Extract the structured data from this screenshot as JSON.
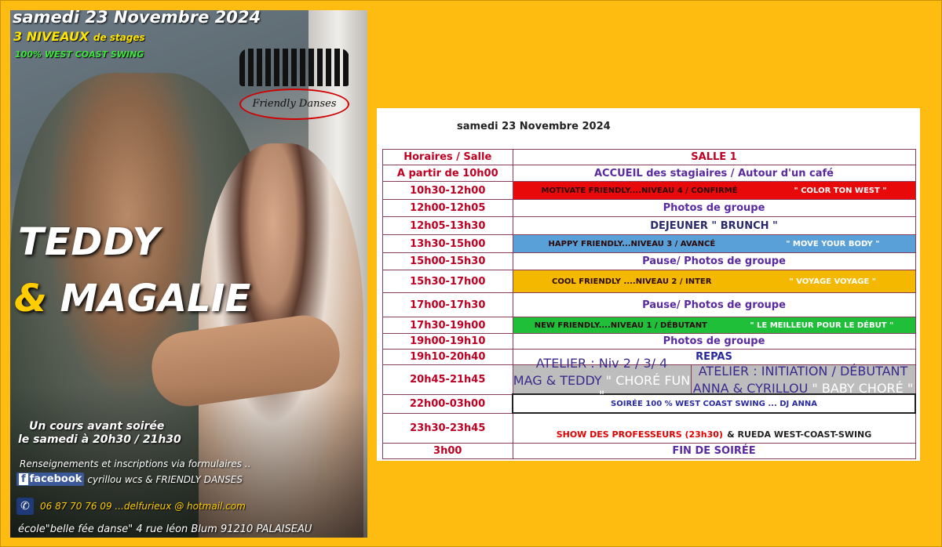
{
  "poster": {
    "date": "samedi 23 Novembre 2024",
    "levels_big": "3 NIVEAUX",
    "levels_small": "de stages",
    "style": "100% WEST COAST SWING",
    "logo_text": "Friendly Danses",
    "name1": "TEDDY",
    "amp": "&",
    "name2": "MAGALIE",
    "cours_line1": "Un cours  avant soirée",
    "cours_line2": "le samedi à 20h30 / 21h30",
    "renseignements": "Renseignements et inscriptions via formulaires ..",
    "facebook_label": "facebook",
    "facebook_text": "cyrillou wcs & FRIENDLY DANSES",
    "phone_text": "06 87 70 76 09 ...delfurieux @ hotmail.com",
    "address": "école\"belle fée danse\" 4 rue léon Blum 91210 PALAISEAU",
    "colors": {
      "background": "#fdbc0f",
      "accent_yellow": "#ffe600",
      "accent_green": "#3fe53f"
    }
  },
  "schedule": {
    "date": "samedi 23 Novembre 2024",
    "header_time": "Horaires / Salle",
    "header_room": "SALLE 1",
    "rows": [
      {
        "time": "A partir de 10h00",
        "text": "ACCUEIL des stagiaires / Autour d'un café"
      },
      {
        "time": "10h30-12h00",
        "a": "MOTIVATE FRIENDLY....NIVEAU 4 / CONFIRMÉ",
        "b": "\" COLOR TON WEST \""
      },
      {
        "time": "12h00-12h05",
        "text": "Photos de groupe"
      },
      {
        "time": "12h05-13h30",
        "text": "DEJEUNER  \" BRUNCH \""
      },
      {
        "time": "13h30-15h00",
        "a": "HAPPY FRIENDLY...NIVEAU 3 /  AVANCÉ",
        "b": "\" MOVE YOUR BODY \""
      },
      {
        "time": "15h00-15h30",
        "text": "Pause/ Photos de groupe"
      },
      {
        "time": "15h30-17h00",
        "a": "COOL FRIENDLY ....NIVEAU 2 / INTER",
        "b": "\" VOYAGE VOYAGE \""
      },
      {
        "time": "17h00-17h30",
        "text": "Pause/ Photos de groupe"
      },
      {
        "time": "17h30-19h00",
        "a": "NEW FRIENDLY....NIVEAU 1 / DÉBUTANT",
        "b": "\" LE MEILLEUR POUR LE DÉBUT \""
      },
      {
        "time": "19h00-19h10",
        "text": "Photos de groupe"
      },
      {
        "time": "19h10-20h40",
        "text": "REPAS"
      },
      {
        "time": "20h45-21h45",
        "left1": "ATELIER : Niv 2 / 3/ 4",
        "left2a": "MAG & TEDDY",
        "left2b": "\" CHORÉ FUN \"",
        "right1": "ATELIER : INITIATION / DÉBUTANT",
        "right2a": "ANNA  & CYRILLOU",
        "right2b": "\" BABY CHORÉ \""
      },
      {
        "time": "22h00-03h00",
        "text": "SOIRÉE 100 % WEST COAST SWING ... DJ ANNA"
      },
      {
        "time": "23h30-23h45",
        "a": "SHOW DES PROFESSEURS (23h30)",
        "b": "& RUEDA WEST-COAST-SWING"
      },
      {
        "time": "3h00",
        "text": "FIN DE SOIRÉE"
      }
    ],
    "colors": {
      "level4": "#e80a0a",
      "level3": "#5aa0d8",
      "level2": "#f5b800",
      "level1": "#1fbf3a",
      "atelier": "#bdbdbd"
    }
  }
}
